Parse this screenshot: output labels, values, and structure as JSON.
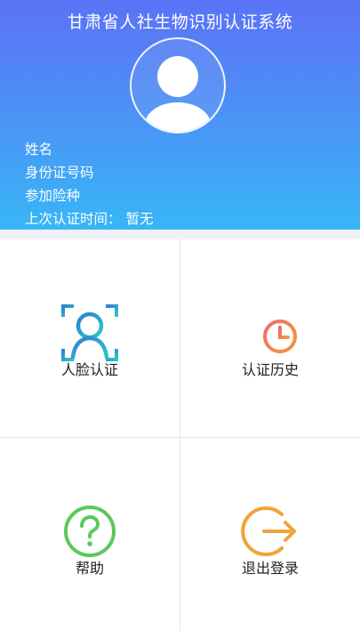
{
  "header": {
    "title": "甘肃省人社生物识别认证系统",
    "name_label": "姓名",
    "id_label": "身份证号码",
    "insurance_label": "参加险种",
    "last_auth_label": "上次认证时间：",
    "last_auth_value": "暂无"
  },
  "menu": {
    "face_auth": "人脸认证",
    "auth_history": "认证历史",
    "help": "帮助",
    "logout": "退出登录"
  },
  "icons": {
    "avatar": "user-avatar-icon",
    "face_auth": "face-scan-icon",
    "auth_history": "history-clock-icon",
    "help": "question-circle-icon",
    "logout": "logout-arrow-icon"
  },
  "colors": {
    "header_top": "#5b72f6",
    "header_bottom": "#38b6f7",
    "face_icon": "#1fa5c9",
    "history_icon": "#f2785a",
    "help_icon": "#5cc85c",
    "logout_icon": "#f2a33a"
  }
}
